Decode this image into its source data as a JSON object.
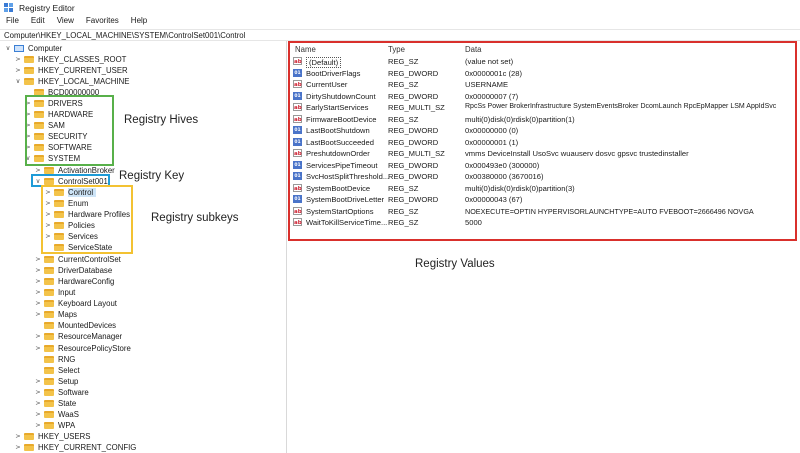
{
  "window": {
    "title": "Registry Editor"
  },
  "menu": [
    "File",
    "Edit",
    "View",
    "Favorites",
    "Help"
  ],
  "address": "Computer\\HKEY_LOCAL_MACHINE\\SYSTEM\\ControlSet001\\Control",
  "tree": {
    "root": "Computer",
    "hkcr": "HKEY_CLASSES_ROOT",
    "hkcu": "HKEY_CURRENT_USER",
    "hklm": "HKEY_LOCAL_MACHINE",
    "bcd": "BCD00000000",
    "drivers": "DRIVERS",
    "hardware": "HARDWARE",
    "sam": "SAM",
    "security": "SECURITY",
    "software": "SOFTWARE",
    "system": "SYSTEM",
    "activation_broker": "ActivationBroker",
    "controlset001": "ControlSet001",
    "control": "Control",
    "enum": "Enum",
    "hardware_profiles": "Hardware Profiles",
    "policies": "Policies",
    "services": "Services",
    "service_state": "ServiceState",
    "current_control_set": "CurrentControlSet",
    "driver_database": "DriverDatabase",
    "hardware_config": "HardwareConfig",
    "input": "Input",
    "keyboard_layout": "Keyboard Layout",
    "maps": "Maps",
    "mounted_devices": "MountedDevices",
    "resource_manager": "ResourceManager",
    "resource_policy_store": "ResourcePolicyStore",
    "rng": "RNG",
    "select": "Select",
    "setup": "Setup",
    "software2": "Software",
    "state": "State",
    "waas": "WaaS",
    "wpa": "WPA",
    "hku": "HKEY_USERS",
    "hkcc": "HKEY_CURRENT_CONFIG"
  },
  "annotations": {
    "hives": "Registry Hives",
    "key": "Registry Key",
    "subkeys": "Registry subkeys",
    "values": "Registry Values"
  },
  "columns": {
    "name": "Name",
    "type": "Type",
    "data": "Data"
  },
  "values": [
    {
      "icon": "string-value-icon",
      "name": "(Default)",
      "type": "REG_SZ",
      "data": "(value not set)"
    },
    {
      "icon": "binary-value-icon",
      "name": "BootDriverFlags",
      "type": "REG_DWORD",
      "data": "0x0000001c (28)"
    },
    {
      "icon": "string-value-icon",
      "name": "CurrentUser",
      "type": "REG_SZ",
      "data": "USERNAME"
    },
    {
      "icon": "binary-value-icon",
      "name": "DirtyShutdownCount",
      "type": "REG_DWORD",
      "data": "0x00000007 (7)"
    },
    {
      "icon": "string-value-icon",
      "name": "EarlyStartServices",
      "type": "REG_MULTI_SZ",
      "data": "RpcSs Power BrokerInfrastructure SystemEventsBroker DcomLaunch RpcEpMapper LSM AppIdSvc"
    },
    {
      "icon": "string-value-icon",
      "name": "FirmwareBootDevice",
      "type": "REG_SZ",
      "data": "multi(0)disk(0)rdisk(0)partition(1)"
    },
    {
      "icon": "binary-value-icon",
      "name": "LastBootShutdown",
      "type": "REG_DWORD",
      "data": "0x00000000 (0)"
    },
    {
      "icon": "binary-value-icon",
      "name": "LastBootSucceeded",
      "type": "REG_DWORD",
      "data": "0x00000001 (1)"
    },
    {
      "icon": "string-value-icon",
      "name": "PreshutdownOrder",
      "type": "REG_MULTI_SZ",
      "data": "vmms DeviceInstall UsoSvc wuauserv dosvc gpsvc trustedinstaller"
    },
    {
      "icon": "binary-value-icon",
      "name": "ServicesPipeTimeout",
      "type": "REG_DWORD",
      "data": "0x000493e0 (300000)"
    },
    {
      "icon": "binary-value-icon",
      "name": "SvcHostSplitThreshold...",
      "type": "REG_DWORD",
      "data": "0x00380000 (3670016)"
    },
    {
      "icon": "string-value-icon",
      "name": "SystemBootDevice",
      "type": "REG_SZ",
      "data": "multi(0)disk(0)rdisk(0)partition(3)"
    },
    {
      "icon": "binary-value-icon",
      "name": "SystemBootDriveLetter",
      "type": "REG_DWORD",
      "data": "0x00000043 (67)"
    },
    {
      "icon": "string-value-icon",
      "name": "SystemStartOptions",
      "type": "REG_SZ",
      "data": "NOEXECUTE=OPTIN  HYPERVISORLAUNCHTYPE=AUTO  FVEBOOT=2666496  NOVGA"
    },
    {
      "icon": "string-value-icon",
      "name": "WaitToKillServiceTime...",
      "type": "REG_SZ",
      "data": "5000"
    }
  ]
}
